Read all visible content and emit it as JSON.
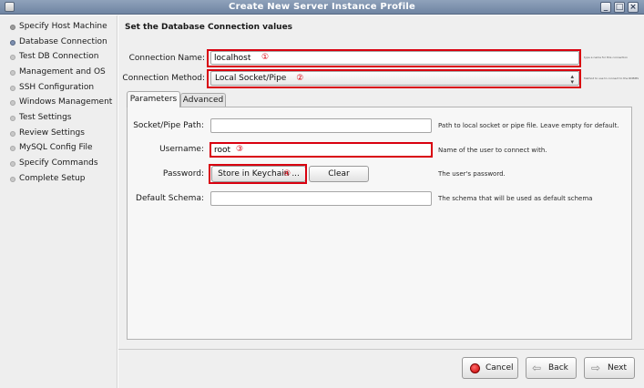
{
  "window": {
    "title": "Create New Server Instance Profile",
    "controls": [
      "_",
      "□",
      "×"
    ]
  },
  "sidebar": {
    "steps": [
      {
        "label": "Specify Host Machine",
        "state": "done"
      },
      {
        "label": "Database Connection",
        "state": "current"
      },
      {
        "label": "Test DB Connection",
        "state": "pending"
      },
      {
        "label": "Management and OS",
        "state": "pending"
      },
      {
        "label": "SSH Configuration",
        "state": "pending"
      },
      {
        "label": "Windows Management",
        "state": "pending"
      },
      {
        "label": "Test Settings",
        "state": "pending"
      },
      {
        "label": "Review Settings",
        "state": "pending"
      },
      {
        "label": "MySQL Config File",
        "state": "pending"
      },
      {
        "label": "Specify Commands",
        "state": "pending"
      },
      {
        "label": "Complete Setup",
        "state": "pending"
      }
    ]
  },
  "main": {
    "heading": "Set the Database Connection values",
    "connection_name": {
      "label": "Connection Name:",
      "value": "localhost",
      "marker": "①",
      "hint": "type a name for this connection"
    },
    "connection_method": {
      "label": "Connection Method:",
      "value": "Local Socket/Pipe",
      "marker": "②",
      "hint": "Method to use to connect to the RDBMS"
    },
    "tabs": [
      {
        "label": "Parameters",
        "active": true
      },
      {
        "label": "Advanced",
        "active": false
      }
    ],
    "parameters": {
      "socket": {
        "label": "Socket/Pipe Path:",
        "value": "",
        "description": "Path to local socket or pipe file. Leave empty for default."
      },
      "username": {
        "label": "Username:",
        "value": "root",
        "marker": "③",
        "description": "Name of the user to connect with."
      },
      "password": {
        "label": "Password:",
        "store_button": "Store in Keychain ...",
        "marker": "④",
        "clear_button": "Clear",
        "description": "The user's password."
      },
      "schema": {
        "label": "Default Schema:",
        "value": "",
        "description": "The schema that will be used as default schema"
      }
    }
  },
  "footer": {
    "cancel": "Cancel",
    "back": "Back",
    "next": "Next"
  },
  "colors": {
    "highlight": "#d9000f",
    "titlebar": "#7f93b0"
  }
}
